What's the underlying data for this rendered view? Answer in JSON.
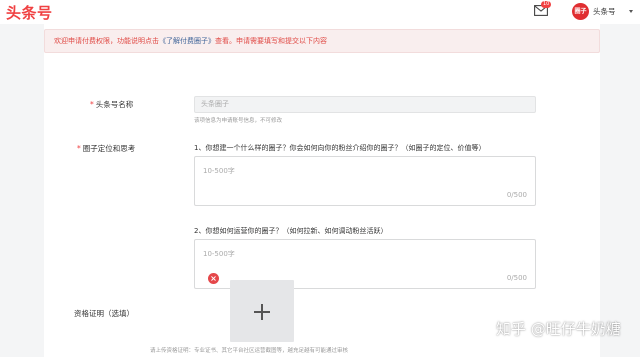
{
  "header": {
    "logo_text": "头条号",
    "mail_badge": "10",
    "avatar_text": "圈子",
    "user_name": "头条号"
  },
  "notice": {
    "prefix": "欢迎申请付费权限，功能说明点击",
    "link": "《了解付费圈子》",
    "suffix": "查看。申请需要填写和提交以下内容"
  },
  "form": {
    "name_label": "头条号名称",
    "name_value": "头条圈子",
    "name_hint": "该项信息为申请账号信息，不可修改",
    "circle_label": "圈子定位和思考",
    "q1": "1、你想建一个什么样的圈子？你会如何向你的粉丝介绍你的圈子？（如圈子的定位、价值等）",
    "q1_placeholder": "10-500字",
    "q1_count": "0/500",
    "q2": "2、你想如何运营你的圈子？（如何拉新、如何调动粉丝活跃）",
    "q2_placeholder": "10-500字",
    "q2_count": "0/500",
    "qualification_label": "资格证明（选填）",
    "upload_hint": "请上传资格证明：专业证书、其它平台社区运营截图等，越充足越有可能通过审核",
    "remove_symbol": "×"
  },
  "watermark": "知乎 @旺仔牛奶糖"
}
